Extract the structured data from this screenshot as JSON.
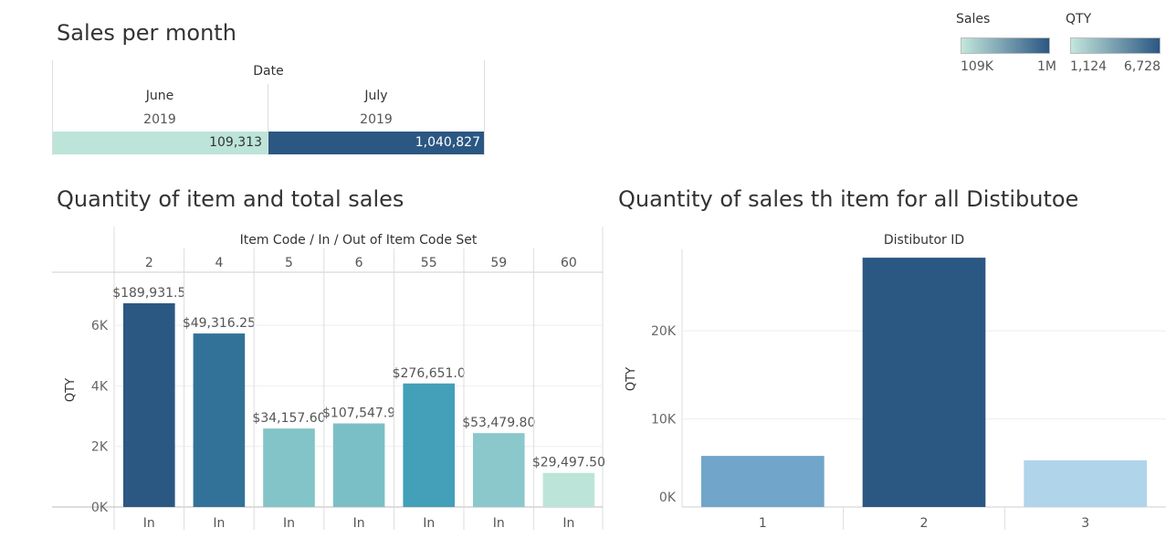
{
  "dashboard": {
    "sales_title": "Sales per month",
    "qty_title": "Quantity of item and total sales",
    "dist_title": "Quantity of sales th item for all Distibutoe"
  },
  "legends": {
    "sales": {
      "label": "Sales",
      "min": "109K",
      "max": "1M",
      "from_color": "#c3e6dc",
      "to_color": "#2b5783"
    },
    "qty": {
      "label": "QTY",
      "min": "1,124",
      "max": "6,728",
      "from_color": "#c3e6dc",
      "to_color": "#2b5783"
    }
  },
  "sales_table": {
    "header": "Date",
    "columns": [
      {
        "month": "June",
        "year": "2019",
        "value": "109,313",
        "color": "#bde4d8",
        "text_color": "#333333"
      },
      {
        "month": "July",
        "year": "2019",
        "value": "1,040,827",
        "color": "#2b5783",
        "text_color": "#ffffff"
      }
    ]
  },
  "chart_data": [
    {
      "type": "bar",
      "title": "Quantity of item and total sales",
      "column_header": "Item Code / In / Out of Item Code Set",
      "ylabel": "QTY",
      "ylim": [
        0,
        6728
      ],
      "yticks": [
        0,
        2000,
        4000,
        6000
      ],
      "ytick_labels": [
        "0K",
        "2K",
        "4K",
        "6K"
      ],
      "categories": [
        "2",
        "4",
        "5",
        "6",
        "55",
        "59",
        "60"
      ],
      "set_labels": [
        "In",
        "In",
        "In",
        "In",
        "In",
        "In",
        "In"
      ],
      "values": [
        6728,
        5730,
        2590,
        2760,
        4080,
        2440,
        1124
      ],
      "bar_labels": [
        "$189,931.5",
        "$49,316.25",
        "$34,157.60",
        "$107,547.9",
        "$276,651.0",
        "$53,479.80",
        "$29,497.50"
      ],
      "colors": [
        "#2b5783",
        "#337298",
        "#82c4c7",
        "#7bbfc6",
        "#449fb9",
        "#8ac8cc",
        "#bde4d8"
      ],
      "grid": true
    },
    {
      "type": "bar",
      "title": "Quantity of sales th item for all Distibutoe",
      "column_header": "Distibutor ID",
      "ylabel": "QTY",
      "ylim": [
        0,
        28000
      ],
      "yticks": [
        0,
        10000,
        20000
      ],
      "ytick_labels": [
        "0K",
        "10K",
        "20K"
      ],
      "categories": [
        "1",
        "2",
        "3"
      ],
      "values": [
        5800,
        28300,
        5300
      ],
      "colors": [
        "#71a5c9",
        "#2b5783",
        "#b0d4ea"
      ],
      "grid": true
    }
  ]
}
